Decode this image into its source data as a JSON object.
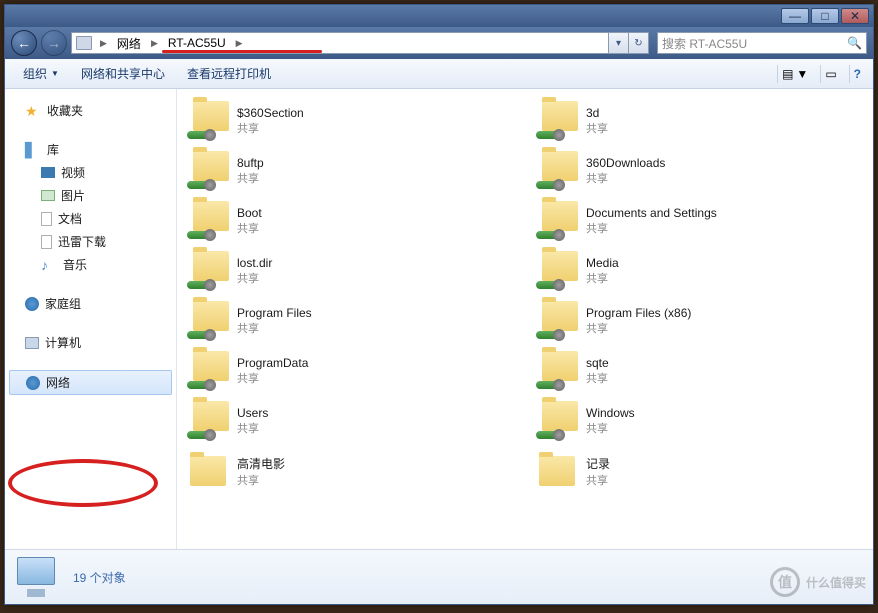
{
  "titlebar": {
    "min": "—",
    "max": "□",
    "close": "✕"
  },
  "nav": {
    "back": "←",
    "fwd": "→"
  },
  "breadcrumb": {
    "items": [
      "网络",
      "RT-AC55U"
    ],
    "arrow": "▶"
  },
  "address_controls": {
    "dropdown": "▾",
    "refresh": "↻"
  },
  "search": {
    "placeholder": "搜索 RT-AC55U",
    "icon": "🔍"
  },
  "toolbar": {
    "organize": "组织",
    "networkcenter": "网络和共享中心",
    "remoteprint": "查看远程打印机",
    "viewicon": "▤",
    "helpicon": "?"
  },
  "sidebar": {
    "favorites": "收藏夹",
    "libraries": "库",
    "libs": {
      "video": "视频",
      "pictures": "图片",
      "documents": "文档",
      "xunlei": "迅雷下载",
      "music": "音乐"
    },
    "homegroup": "家庭组",
    "computer": "计算机",
    "network": "网络"
  },
  "share_sub": "共享",
  "folders": [
    {
      "name": "$360Section"
    },
    {
      "name": "3d"
    },
    {
      "name": "8uftp"
    },
    {
      "name": "360Downloads"
    },
    {
      "name": "Boot"
    },
    {
      "name": "Documents and Settings"
    },
    {
      "name": "lost.dir"
    },
    {
      "name": "Media"
    },
    {
      "name": "Program Files"
    },
    {
      "name": "Program Files (x86)"
    },
    {
      "name": "ProgramData"
    },
    {
      "name": "sqte"
    },
    {
      "name": "Users"
    },
    {
      "name": "Windows"
    },
    {
      "name": "高清电影",
      "plain": true
    },
    {
      "name": "记录",
      "plain": true
    }
  ],
  "details": {
    "count": "19 个对象"
  },
  "watermark": {
    "badge": "值",
    "text": "什么值得买"
  }
}
